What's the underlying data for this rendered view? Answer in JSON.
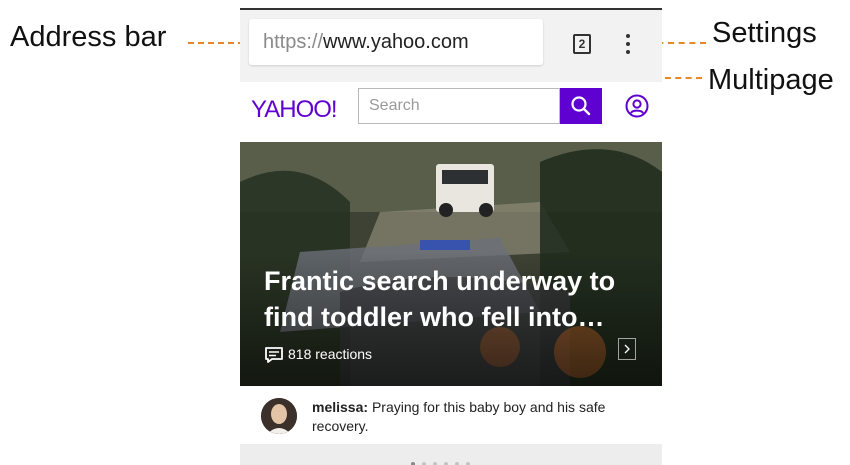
{
  "annotations": {
    "address_bar": "Address bar",
    "settings": "Settings",
    "multipage": "Multipage"
  },
  "browser": {
    "url_scheme": "https://",
    "url_host": "www.yahoo.com",
    "tab_count": "2"
  },
  "yahoo": {
    "logo": "YAHOO!",
    "search_placeholder": "Search"
  },
  "story": {
    "headline": "Frantic search underway to find toddler who fell into…",
    "reactions": "818 reactions"
  },
  "comment": {
    "user": "melissa:",
    "text": "Praying for this baby boy and his safe recovery."
  },
  "pager": {
    "count": 6,
    "active_index": 0
  },
  "colors": {
    "callout": "#e8862a",
    "yahoo_purple": "#5f01d1"
  }
}
